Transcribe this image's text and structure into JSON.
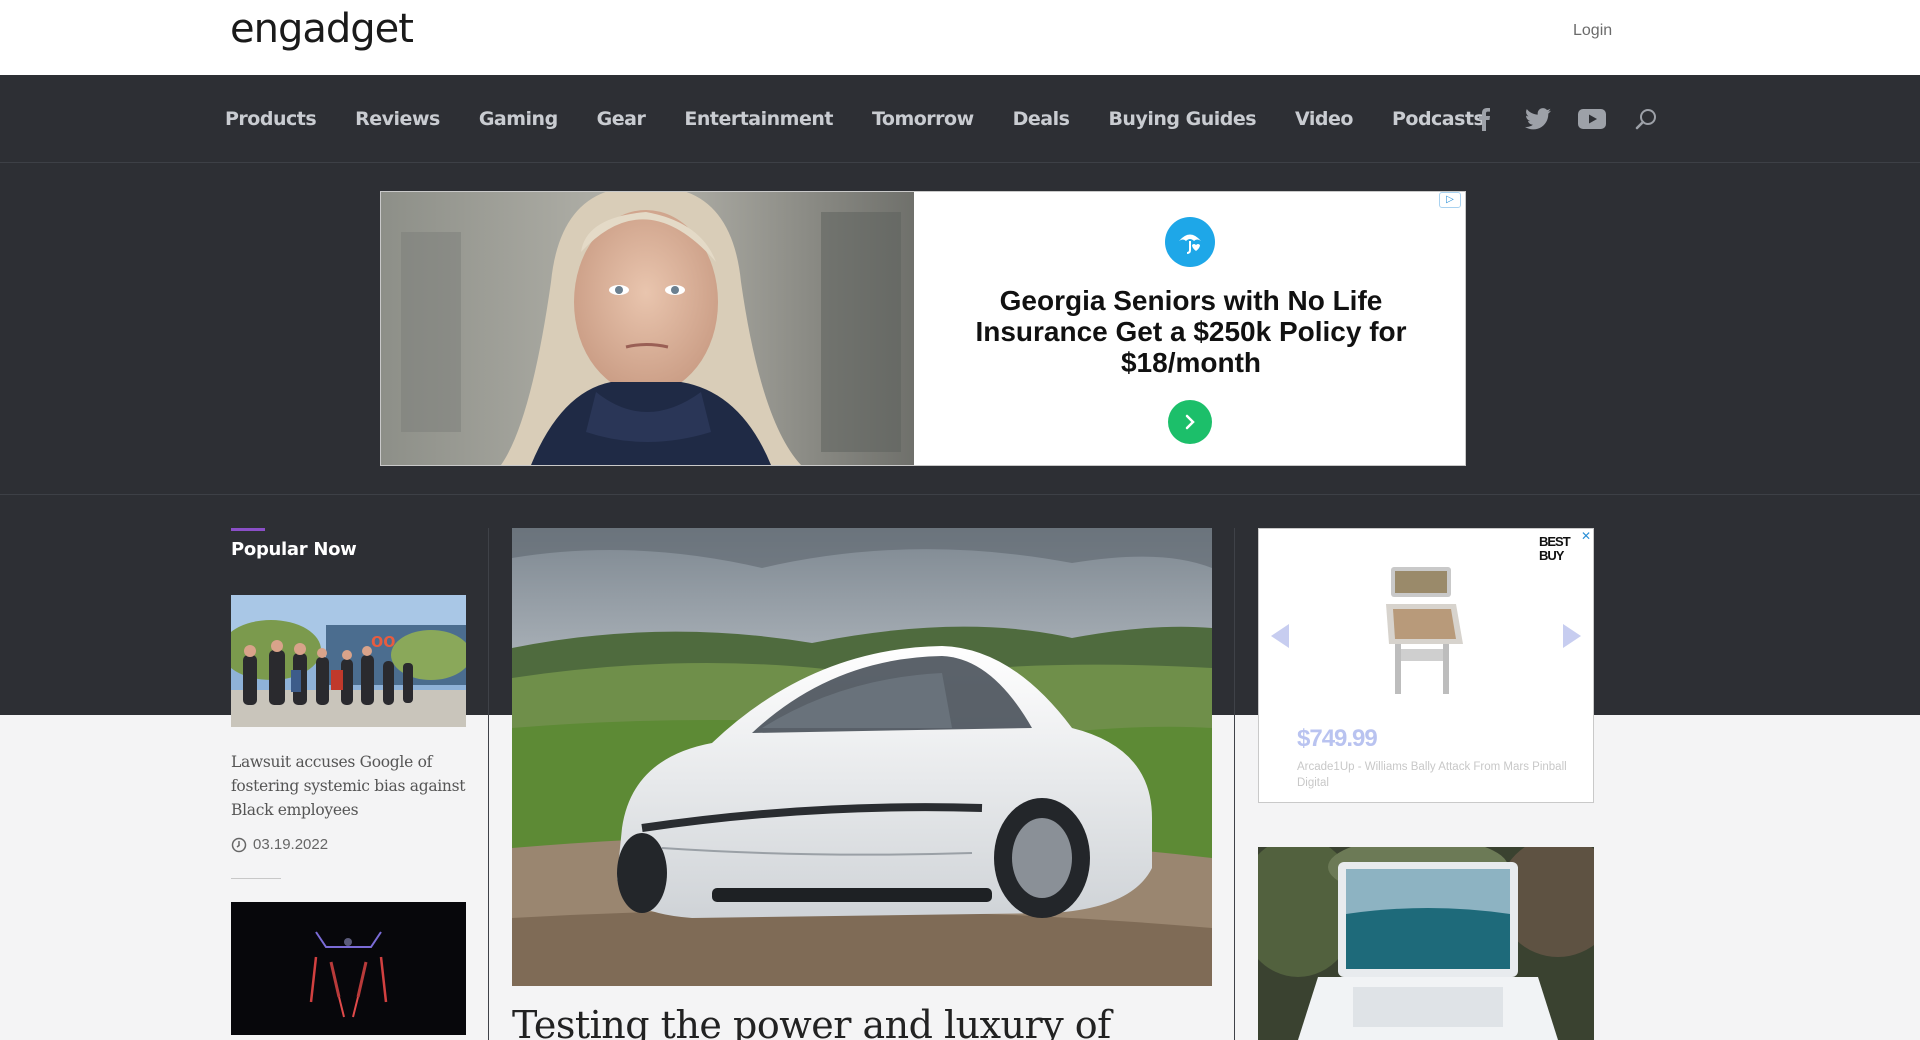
{
  "header": {
    "logo": "engadget",
    "login_label": "Login"
  },
  "nav": {
    "items": [
      "Products",
      "Reviews",
      "Gaming",
      "Gear",
      "Entertainment",
      "Tomorrow",
      "Deals",
      "Buying Guides",
      "Video",
      "Podcasts"
    ],
    "icons": [
      "facebook-icon",
      "twitter-icon",
      "youtube-icon",
      "search-icon"
    ]
  },
  "top_ad": {
    "headline": "Georgia Seniors with No Life Insurance Get a $250k Policy for $18/month",
    "badge": "▷"
  },
  "popular": {
    "heading": "Popular Now",
    "stories": [
      {
        "title": "Lawsuit accuses Google of fostering systemic bias against Black employees",
        "date": "03.19.2022"
      }
    ]
  },
  "main_story": {
    "title": "Testing the power and luxury of"
  },
  "side_ad": {
    "brand": "BEST BUY",
    "price": "$749.99",
    "description": "Arcade1Up - Williams Bally Attack From Mars Pinball Digital"
  },
  "colors": {
    "nav_bg": "#2d2f34",
    "accent": "#8a4fc7",
    "cta_green": "#1cbf6a",
    "umbrella_blue": "#1ea7e8"
  }
}
